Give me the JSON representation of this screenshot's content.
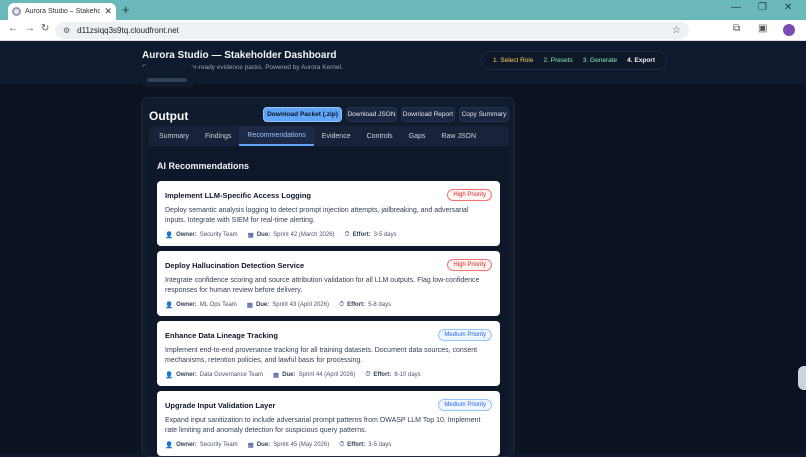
{
  "browser": {
    "tab_title": "Aurora Studio – Stakeholder Da",
    "url": "d11zsiqq3s9tq.cloudfront.net"
  },
  "app": {
    "title": "Aurora Studio — Stakeholder Dashboard",
    "subtitle": "Generate regulator-ready evidence packs. Powered by Aurora Kernel.",
    "steps": [
      "1. Select Role",
      "2. Presets",
      "3. Generate",
      "4. Export"
    ]
  },
  "output": {
    "title": "Output",
    "buttons": {
      "download_packet": "Download Packet (.zip)",
      "download_json": "Download JSON",
      "download_report": "Download Report",
      "copy_summary": "Copy Summary"
    },
    "tabs": [
      "Summary",
      "Findings",
      "Recommendations",
      "Evidence",
      "Controls",
      "Gaps",
      "Raw JSON"
    ],
    "active_tab": "Recommendations",
    "section_title": "AI Recommendations",
    "labels": {
      "owner": "Owner:",
      "due": "Due:",
      "effort": "Effort:"
    },
    "recommendations": [
      {
        "title": "Implement LLM-Specific Access Logging",
        "priority": "High Priority",
        "description": "Deploy semantic analysis logging to detect prompt injection attempts, jailbreaking, and adversarial inputs. Integrate with SIEM for real-time alerting.",
        "owner": "Security Team",
        "due": "Sprint 42 (March 2026)",
        "effort": "3-5 days"
      },
      {
        "title": "Deploy Hallucination Detection Service",
        "priority": "High Priority",
        "description": "Integrate confidence scoring and source attribution validation for all LLM outputs. Flag low-confidence responses for human review before delivery.",
        "owner": "ML Ops Team",
        "due": "Sprint 43 (April 2026)",
        "effort": "5-8 days"
      },
      {
        "title": "Enhance Data Lineage Tracking",
        "priority": "Medium Priority",
        "description": "Implement end-to-end provenance tracking for all training datasets. Document data sources, consent mechanisms, retention policies, and lawful basis for processing.",
        "owner": "Data Governance Team",
        "due": "Sprint 44 (April 2026)",
        "effort": "8-10 days"
      },
      {
        "title": "Upgrade Input Validation Layer",
        "priority": "Medium Priority",
        "description": "Expand input sanitization to include adversarial prompt patterns from OWASP LLM Top 10. Implement rate limiting and anomaly detection for suspicious query patterns.",
        "owner": "Security Team",
        "due": "Sprint 45 (May 2026)",
        "effort": "3-5 days"
      }
    ]
  },
  "colors": {
    "accent": "#60a5fa",
    "high_priority": "#dc2626",
    "medium_priority": "#2563eb",
    "step_done": "#86efac",
    "step_pending": "#fcd34d"
  }
}
